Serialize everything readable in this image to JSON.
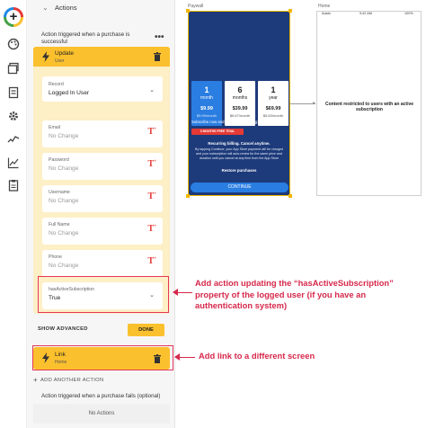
{
  "rail": {
    "icons": [
      "add-icon",
      "palette-icon",
      "screens-icon",
      "data-icon",
      "settings-icon",
      "analytics-icon",
      "chart-icon",
      "clipboard-icon"
    ]
  },
  "actions_panel": {
    "header": {
      "title": "Actions"
    },
    "trigger_text": "Action triggered when a purchase is successful",
    "more_label": "•••",
    "update_card": {
      "title": "Update",
      "subtitle": "User",
      "record_field": {
        "label": "Record",
        "value": "Logged In User"
      },
      "fields": [
        {
          "label": "Email",
          "value": "No Change"
        },
        {
          "label": "Password",
          "value": "No Change"
        },
        {
          "label": "Username",
          "value": "No Change"
        },
        {
          "label": "Full Name",
          "value": "No Change"
        },
        {
          "label": "Phone",
          "value": "No Change"
        }
      ],
      "has_active_subscription": {
        "label": "hasActiveSubscription",
        "value": "True"
      },
      "show_advanced_label": "SHOW ADVANCED",
      "done_label": "DONE"
    },
    "link_card": {
      "title": "Link",
      "subtitle": "Home"
    },
    "add_action_label": "ADD ANOTHER ACTION",
    "fail_text": "Action triggered when a purchase fails (optional)",
    "no_actions_label": "No Actions"
  },
  "canvas": {
    "paywall_label": "Paywall",
    "home_label": "Home",
    "plans": [
      {
        "num": "1",
        "unit": "month",
        "price": "$9.99",
        "per": "$9.99/month"
      },
      {
        "num": "6",
        "unit": "months",
        "price": "$39.99",
        "per": "$6.67/month"
      },
      {
        "num": "1",
        "unit": "year",
        "price": "$69.99",
        "per": "$5.83/month"
      }
    ],
    "subscribe_text": "Subscribe now and enjoy the following:",
    "trial_badge": "3 MONTHS FREE TRIAL",
    "recurring_title": "Recurring billing. Cancel anytime.",
    "recurring_body": "By tapping Continue, your App Store payment will be charged and your subscription will auto-renew for the same price and duration until you cancel at any time from the App Store",
    "restore_label": "Restore purchases",
    "continue_label": "CONTINUE",
    "status_carrier": "Adalo",
    "status_time": "9:42 AM",
    "status_battery": "100%",
    "restricted_text": "Content restricted to users with an active subscription"
  },
  "annotations": {
    "update_note": "Add action updating the “hasActiveSubscription” property of the logged user (if you have an authentication system)",
    "link_note": "Add link to a different screen"
  },
  "colors": {
    "accent_yellow": "#fbc02d",
    "card_bg": "#fdefc6",
    "annotation_red": "#d6284b",
    "paywall_blue": "#1d3a7a",
    "plan_selected": "#2a7de1"
  }
}
